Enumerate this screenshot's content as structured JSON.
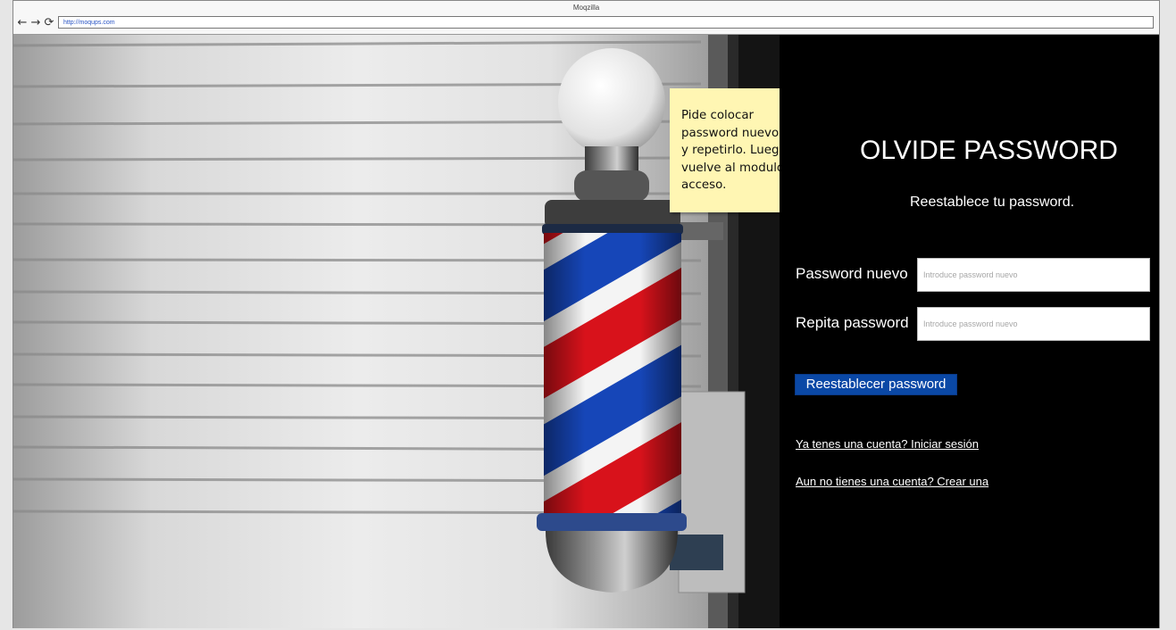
{
  "window": {
    "title": "Moqzilla"
  },
  "nav": {
    "back_icon": "arrow-left-icon",
    "forward_icon": "arrow-right-icon",
    "reload_icon": "reload-icon",
    "url": "http://moqups.com"
  },
  "sticky_note": {
    "lines": [
      "Pide colocar",
      "password nuevo",
      "y repetirlo. Luego",
      "vuelve al modulo",
      "acceso."
    ]
  },
  "panel": {
    "title": "OLVIDE PASSWORD",
    "subtitle": "Reestablece tu password.",
    "fields": [
      {
        "label": "Password nuevo",
        "placeholder": "Introduce password nuevo",
        "value": ""
      },
      {
        "label": "Repita password",
        "placeholder": "Introduce password nuevo",
        "value": ""
      }
    ],
    "submit_label": "Reestablecer password",
    "login_link": "Ya tenes una cuenta? Iniciar sesión",
    "signup_link": "Aun no tienes una cuenta? Crear una"
  },
  "colors": {
    "panel_bg": "#000000",
    "button_bg": "#0a48a6",
    "note_bg": "#fff6b3",
    "pole_red": "#d8121b",
    "pole_blue": "#1646b8"
  }
}
